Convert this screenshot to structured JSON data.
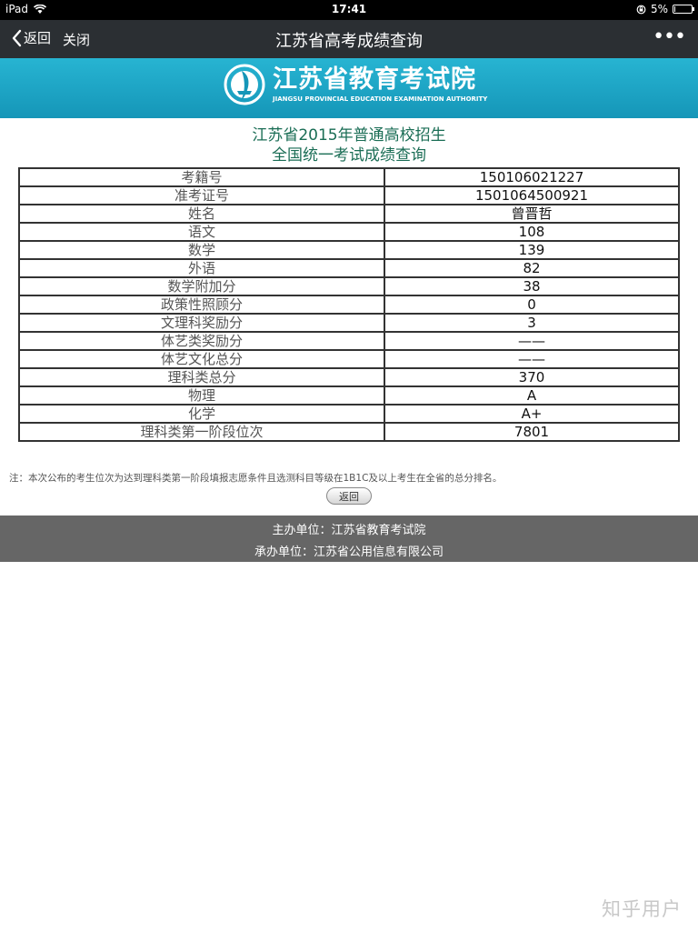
{
  "status_bar": {
    "device": "iPad",
    "time": "17:41",
    "battery": "5%"
  },
  "nav": {
    "back_label": "返回",
    "close_label": "关闭",
    "title": "江苏省高考成绩查询",
    "more_label": "•••"
  },
  "banner": {
    "name": "江苏省教育考试院",
    "subtitle": "JIANGSU PROVINCIAL EDUCATION EXAMINATION AUTHORITY"
  },
  "heading": {
    "line1": "江苏省2015年普通高校招生",
    "line2": "全国统一考试成绩查询"
  },
  "table": {
    "rows": [
      {
        "label": "考籍号",
        "value": "150106021227"
      },
      {
        "label": "准考证号",
        "value": "1501064500921"
      },
      {
        "label": "姓名",
        "value": "曾晋哲"
      },
      {
        "label": "语文",
        "value": "108"
      },
      {
        "label": "数学",
        "value": "139"
      },
      {
        "label": "外语",
        "value": "82"
      },
      {
        "label": "数学附加分",
        "value": "38"
      },
      {
        "label": "政策性照顾分",
        "value": "0"
      },
      {
        "label": "文理科奖励分",
        "value": "3"
      },
      {
        "label": "体艺类奖励分",
        "value": "——"
      },
      {
        "label": "体艺文化总分",
        "value": "——"
      },
      {
        "label": "理科类总分",
        "value": "370"
      },
      {
        "label": "物理",
        "value": "A"
      },
      {
        "label": "化学",
        "value": "A+"
      },
      {
        "label": "理科类第一阶段位次",
        "value": "7801"
      }
    ]
  },
  "note": "注：本次公布的考生位次为达到理科类第一阶段填报志愿条件且选测科目等级在1B1C及以上考生在全省的总分排名。",
  "back_button_label": "返回",
  "footer": {
    "sponsor": "主办单位：江苏省教育考试院",
    "organizer": "承办单位：江苏省公用信息有限公司"
  },
  "watermark": "知乎用户",
  "battery_level": 0.05,
  "colors": {
    "nav_bg": "#2b2f33",
    "banner_bg": "#1aa3c4",
    "heading": "#1a6d55",
    "footer_bg": "#666666"
  }
}
